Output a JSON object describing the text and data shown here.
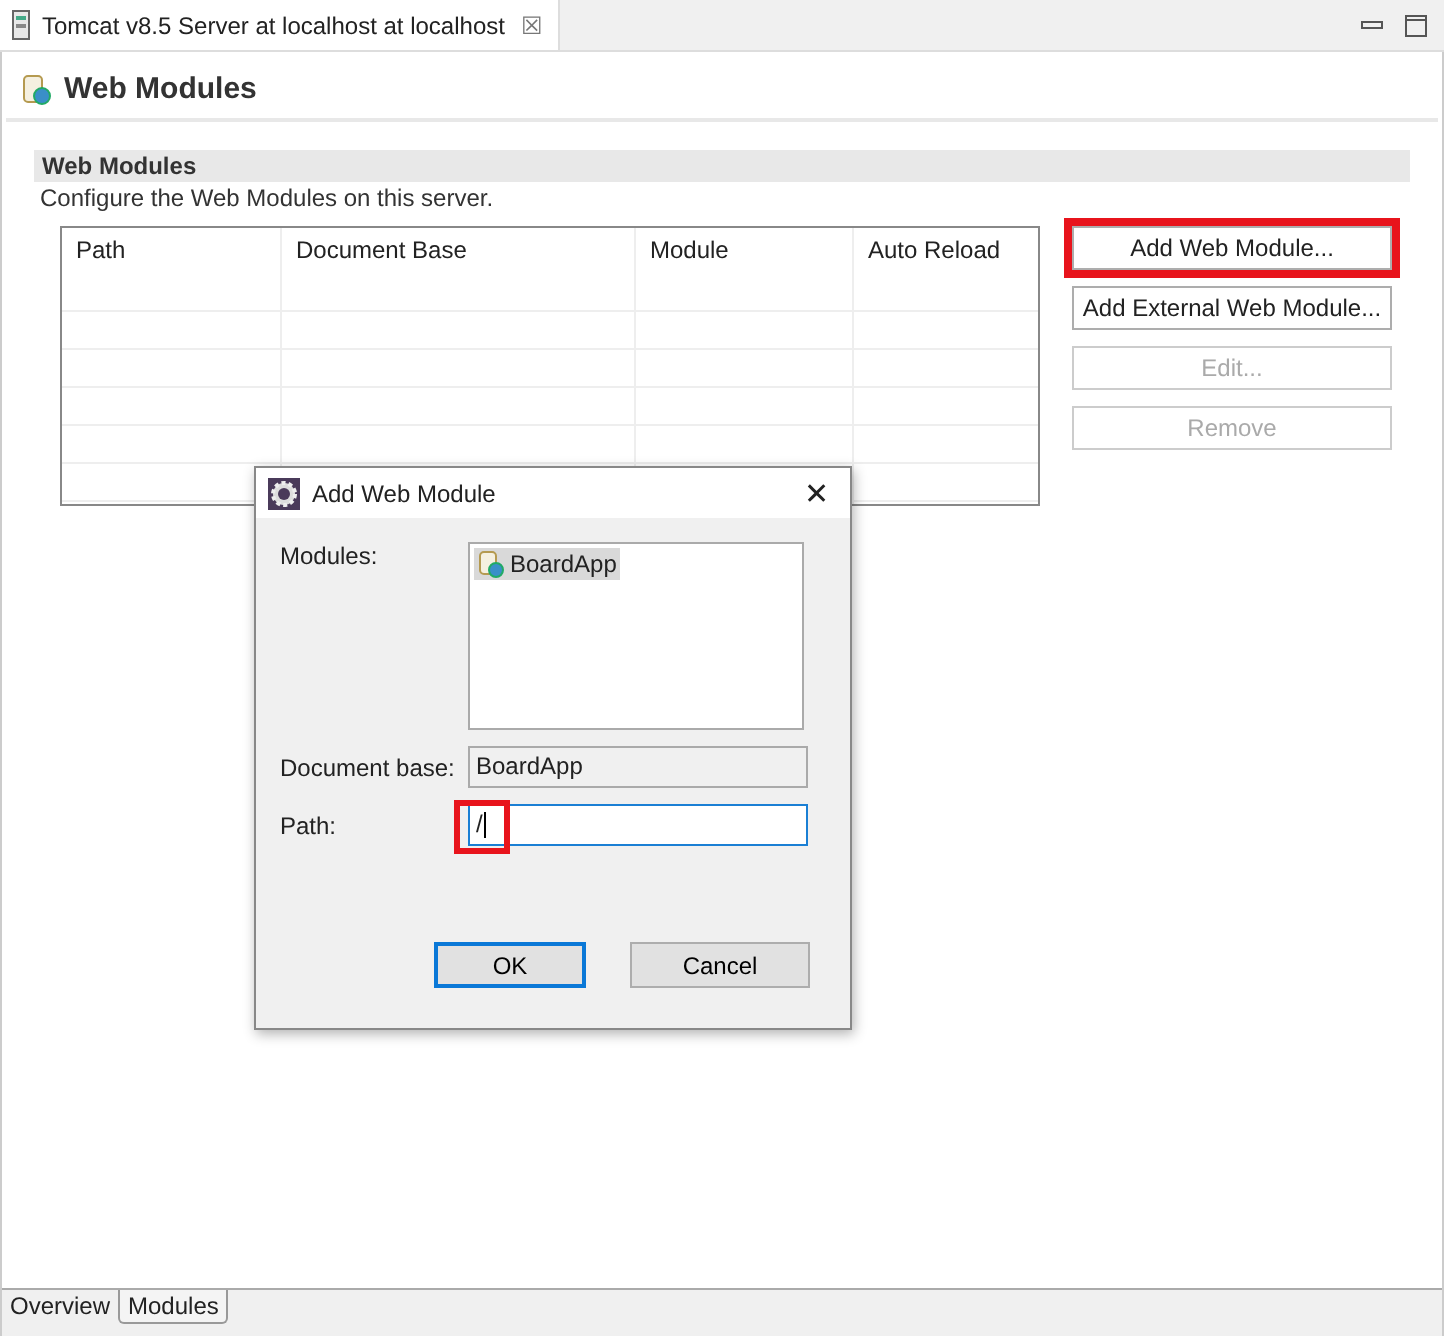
{
  "editor_tab": {
    "title": "Tomcat v8.5 Server at localhost at localhost",
    "close": "☒"
  },
  "header": {
    "title": "Web Modules"
  },
  "section": {
    "title": "Web Modules",
    "description": "Configure the Web Modules on this server."
  },
  "table": {
    "columns": [
      "Path",
      "Document Base",
      "Module",
      "Auto Reload"
    ]
  },
  "buttons": [
    {
      "label": "Add Web Module...",
      "disabled": false,
      "highlighted": true
    },
    {
      "label": "Add External Web Module...",
      "disabled": false,
      "highlighted": false
    },
    {
      "label": "Edit...",
      "disabled": true,
      "highlighted": false
    },
    {
      "label": "Remove",
      "disabled": true,
      "highlighted": false
    }
  ],
  "dialog": {
    "title": "Add Web Module",
    "close": "✕",
    "modules_label": "Modules:",
    "modules": [
      {
        "name": "BoardApp",
        "selected": true
      }
    ],
    "document_base_label": "Document base:",
    "document_base": "BoardApp",
    "path_label": "Path:",
    "path": "/",
    "path_highlighted": true,
    "buttons": [
      {
        "label": "OK",
        "default": true
      },
      {
        "label": "Cancel",
        "default": false
      }
    ]
  },
  "bottom_tabs": [
    {
      "label": "Overview",
      "selected": false
    },
    {
      "label": "Modules",
      "selected": true
    }
  ]
}
